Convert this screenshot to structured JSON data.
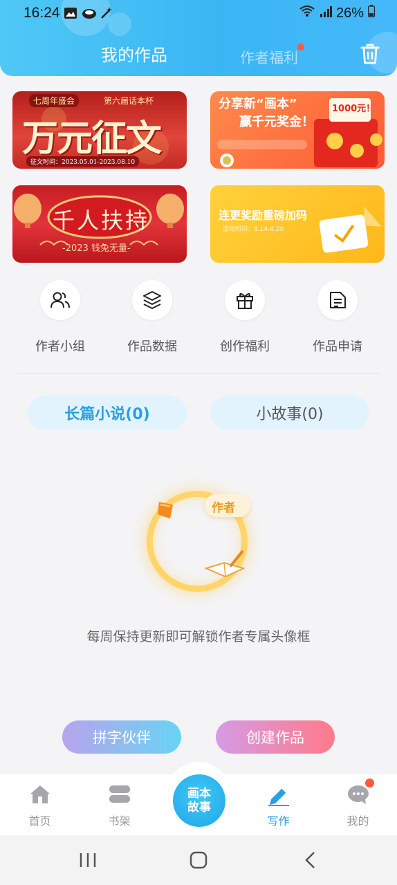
{
  "status_bar": {
    "time": "16:24",
    "battery": "26%"
  },
  "header": {
    "tab_active": "我的作品",
    "tab_inactive": "作者福利"
  },
  "banners": [
    {
      "tag": "七周年盛会",
      "subtitle": "第六届话本杯",
      "title": "万元征文",
      "date": "征文时间：2023.05.01-2023.08.10"
    },
    {
      "title_line1": "分享新“画本”",
      "title_line2": "赢千元奖金！",
      "amount": "1000元！"
    },
    {
      "title": "千人扶持",
      "subtitle": "-2023 钱兔无量-"
    },
    {
      "title": "连更奖励重磅加码",
      "subtitle": "活动时间：8.14-8.20"
    }
  ],
  "quick_actions": [
    {
      "label": "作者小组",
      "icon": "user-group-icon"
    },
    {
      "label": "作品数据",
      "icon": "layers-icon"
    },
    {
      "label": "创作福利",
      "icon": "gift-icon"
    },
    {
      "label": "作品申请",
      "icon": "document-icon"
    }
  ],
  "categories": [
    {
      "label": "长篇小说(0)",
      "active": true
    },
    {
      "label": "小故事(0)",
      "active": false
    }
  ],
  "empty_state": {
    "badge": "作者",
    "message": "每周保持更新即可解锁作者专属头像框"
  },
  "actions": {
    "partner": "拼字伙伴",
    "create": "创建作品"
  },
  "bottom_nav": {
    "items": [
      {
        "label": "首页",
        "icon": "home-icon"
      },
      {
        "label": "书架",
        "icon": "bookshelf-icon"
      },
      {
        "label": "写作",
        "icon": "pen-icon",
        "active": true
      },
      {
        "label": "我的",
        "icon": "chat-icon"
      }
    ],
    "center_line1": "画本",
    "center_line2": "故事"
  },
  "colors": {
    "accent": "#2a9fe3",
    "header": "#3bb6f4",
    "badge": "#ff5a3c"
  }
}
